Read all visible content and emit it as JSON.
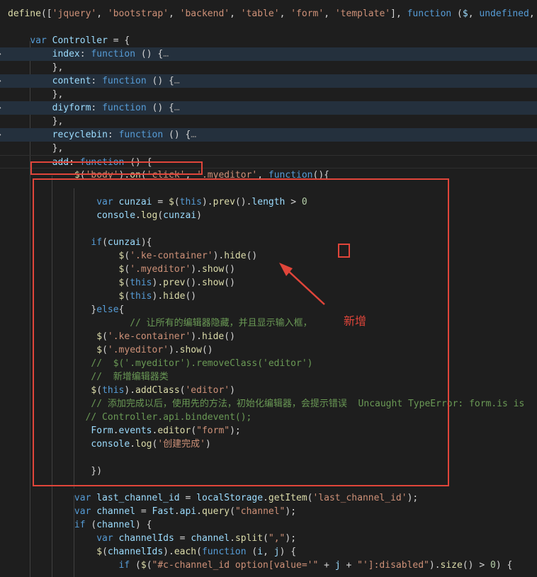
{
  "colors": {
    "background": "#1e1e1e",
    "fold_highlight": "#24303d",
    "annotation": "#e0453a",
    "keyword": "#569cd6",
    "string": "#ce9178",
    "function": "#dcdcaa",
    "variable": "#9cdcfe",
    "comment": "#6a9955",
    "number": "#b5cea8",
    "plain": "#d4d4d4"
  },
  "icons": {
    "fold": "chevron-right-icon"
  },
  "annotation": {
    "label": "新增"
  },
  "lines": [
    {
      "tokens": [
        [
          "define",
          "fn"
        ],
        [
          "([",
          "pl"
        ],
        [
          "'jquery'",
          "str"
        ],
        [
          ", ",
          "pl"
        ],
        [
          "'bootstrap'",
          "str"
        ],
        [
          ", ",
          "pl"
        ],
        [
          "'backend'",
          "str"
        ],
        [
          ", ",
          "pl"
        ],
        [
          "'table'",
          "str"
        ],
        [
          ", ",
          "pl"
        ],
        [
          "'form'",
          "str"
        ],
        [
          ", ",
          "pl"
        ],
        [
          "'template'",
          "str"
        ],
        [
          "], ",
          "pl"
        ],
        [
          "function",
          "kw"
        ],
        [
          " (",
          "pl"
        ],
        [
          "$",
          "var"
        ],
        [
          ", ",
          "pl"
        ],
        [
          "undefined",
          "kw"
        ],
        [
          ", B",
          "pl"
        ]
      ]
    },
    {
      "tokens": []
    },
    {
      "tokens": [
        [
          "    ",
          "pl"
        ],
        [
          "var",
          "kw"
        ],
        [
          " ",
          "pl"
        ],
        [
          "Controller",
          "var"
        ],
        [
          " = {",
          "pl"
        ]
      ]
    },
    {
      "fold": true,
      "tokens": [
        [
          "        ",
          "pl"
        ],
        [
          "index",
          "var"
        ],
        [
          ": ",
          "pl"
        ],
        [
          "function",
          "kw"
        ],
        [
          " () {",
          "pl"
        ],
        [
          "…",
          "ell"
        ]
      ]
    },
    {
      "tokens": [
        [
          "        },",
          "pl"
        ]
      ]
    },
    {
      "fold": true,
      "tokens": [
        [
          "        ",
          "pl"
        ],
        [
          "content",
          "var"
        ],
        [
          ": ",
          "pl"
        ],
        [
          "function",
          "kw"
        ],
        [
          " () {",
          "pl"
        ],
        [
          "…",
          "ell"
        ]
      ]
    },
    {
      "tokens": [
        [
          "        },",
          "pl"
        ]
      ]
    },
    {
      "fold": true,
      "tokens": [
        [
          "        ",
          "pl"
        ],
        [
          "diyform",
          "var"
        ],
        [
          ": ",
          "pl"
        ],
        [
          "function",
          "kw"
        ],
        [
          " () {",
          "pl"
        ],
        [
          "…",
          "ell"
        ]
      ]
    },
    {
      "tokens": [
        [
          "        },",
          "pl"
        ]
      ]
    },
    {
      "fold": true,
      "tokens": [
        [
          "        ",
          "pl"
        ],
        [
          "recyclebin",
          "var"
        ],
        [
          ": ",
          "pl"
        ],
        [
          "function",
          "kw"
        ],
        [
          " () {",
          "pl"
        ],
        [
          "…",
          "ell"
        ]
      ]
    },
    {
      "tokens": [
        [
          "        },",
          "pl"
        ]
      ]
    },
    {
      "current": true,
      "tokens": [
        [
          "        ",
          "pl"
        ],
        [
          "add",
          "var"
        ],
        [
          ": ",
          "pl"
        ],
        [
          "function",
          "kw"
        ],
        [
          " () {",
          "pl"
        ]
      ]
    },
    {
      "tokens": [
        [
          "            ",
          "pl"
        ],
        [
          "$",
          "fn"
        ],
        [
          "(",
          "pl"
        ],
        [
          "'body'",
          "str"
        ],
        [
          ").",
          "pl"
        ],
        [
          "on",
          "fn"
        ],
        [
          "(",
          "pl"
        ],
        [
          "'click'",
          "str"
        ],
        [
          ", ",
          "pl"
        ],
        [
          "'.myeditor'",
          "str"
        ],
        [
          ", ",
          "pl"
        ],
        [
          "function",
          "kw"
        ],
        [
          "(){",
          "pl"
        ]
      ]
    },
    {
      "tokens": []
    },
    {
      "tokens": [
        [
          "                ",
          "pl"
        ],
        [
          "var",
          "kw"
        ],
        [
          " ",
          "pl"
        ],
        [
          "cunzai",
          "var"
        ],
        [
          " = ",
          "pl"
        ],
        [
          "$",
          "fn"
        ],
        [
          "(",
          "pl"
        ],
        [
          "this",
          "kw"
        ],
        [
          ").",
          "pl"
        ],
        [
          "prev",
          "fn"
        ],
        [
          "().",
          "pl"
        ],
        [
          "length",
          "var"
        ],
        [
          " > ",
          "pl"
        ],
        [
          "0",
          "num"
        ]
      ]
    },
    {
      "tokens": [
        [
          "                ",
          "pl"
        ],
        [
          "console",
          "var"
        ],
        [
          ".",
          "pl"
        ],
        [
          "log",
          "fn"
        ],
        [
          "(",
          "pl"
        ],
        [
          "cunzai",
          "var"
        ],
        [
          ")",
          "pl"
        ]
      ]
    },
    {
      "tokens": []
    },
    {
      "tokens": [
        [
          "               ",
          "pl"
        ],
        [
          "if",
          "kw"
        ],
        [
          "(",
          "pl"
        ],
        [
          "cunzai",
          "var"
        ],
        [
          "){",
          "pl"
        ]
      ]
    },
    {
      "tokens": [
        [
          "                    ",
          "pl"
        ],
        [
          "$",
          "fn"
        ],
        [
          "(",
          "pl"
        ],
        [
          "'.ke-container'",
          "str"
        ],
        [
          ").",
          "pl"
        ],
        [
          "hide",
          "fn"
        ],
        [
          "()",
          "pl"
        ]
      ]
    },
    {
      "tokens": [
        [
          "                    ",
          "pl"
        ],
        [
          "$",
          "fn"
        ],
        [
          "(",
          "pl"
        ],
        [
          "'.myeditor'",
          "str"
        ],
        [
          ").",
          "pl"
        ],
        [
          "show",
          "fn"
        ],
        [
          "()",
          "pl"
        ]
      ]
    },
    {
      "tokens": [
        [
          "                    ",
          "pl"
        ],
        [
          "$",
          "fn"
        ],
        [
          "(",
          "pl"
        ],
        [
          "this",
          "kw"
        ],
        [
          ").",
          "pl"
        ],
        [
          "prev",
          "fn"
        ],
        [
          "().",
          "pl"
        ],
        [
          "show",
          "fn"
        ],
        [
          "()",
          "pl"
        ]
      ]
    },
    {
      "tokens": [
        [
          "                    ",
          "pl"
        ],
        [
          "$",
          "fn"
        ],
        [
          "(",
          "pl"
        ],
        [
          "this",
          "kw"
        ],
        [
          ").",
          "pl"
        ],
        [
          "hide",
          "fn"
        ],
        [
          "()",
          "pl"
        ]
      ]
    },
    {
      "tokens": [
        [
          "               }",
          "pl"
        ],
        [
          "else",
          "kw"
        ],
        [
          "{",
          "pl"
        ]
      ]
    },
    {
      "tokens": [
        [
          "                      ",
          "pl"
        ],
        [
          "// 让所有的编辑器隐藏，并且显示输入框，",
          "cm"
        ]
      ]
    },
    {
      "tokens": [
        [
          "                ",
          "pl"
        ],
        [
          "$",
          "fn"
        ],
        [
          "(",
          "pl"
        ],
        [
          "'.ke-container'",
          "str"
        ],
        [
          ").",
          "pl"
        ],
        [
          "hide",
          "fn"
        ],
        [
          "()",
          "pl"
        ]
      ]
    },
    {
      "tokens": [
        [
          "                ",
          "pl"
        ],
        [
          "$",
          "fn"
        ],
        [
          "(",
          "pl"
        ],
        [
          "'.myeditor'",
          "str"
        ],
        [
          ").",
          "pl"
        ],
        [
          "show",
          "fn"
        ],
        [
          "()",
          "pl"
        ]
      ]
    },
    {
      "tokens": [
        [
          "               ",
          "pl"
        ],
        [
          "//  $('.myeditor').removeClass('editor')",
          "cm"
        ]
      ]
    },
    {
      "tokens": [
        [
          "               ",
          "pl"
        ],
        [
          "//  新增编辑器类",
          "cm"
        ]
      ]
    },
    {
      "tokens": [
        [
          "               ",
          "pl"
        ],
        [
          "$",
          "fn"
        ],
        [
          "(",
          "pl"
        ],
        [
          "this",
          "kw"
        ],
        [
          ").",
          "pl"
        ],
        [
          "addClass",
          "fn"
        ],
        [
          "(",
          "pl"
        ],
        [
          "'editor'",
          "str"
        ],
        [
          ")",
          "pl"
        ]
      ]
    },
    {
      "tokens": [
        [
          "               ",
          "pl"
        ],
        [
          "// 添加完成以后，使用先的方法，初始化编辑器，会提示错误  Uncaught TypeError: form.is is",
          "cm"
        ]
      ]
    },
    {
      "tokens": [
        [
          "              ",
          "pl"
        ],
        [
          "// Controller.api.bindevent();",
          "cm"
        ]
      ]
    },
    {
      "tokens": [
        [
          "               ",
          "pl"
        ],
        [
          "Form",
          "var"
        ],
        [
          ".",
          "pl"
        ],
        [
          "events",
          "var"
        ],
        [
          ".",
          "pl"
        ],
        [
          "editor",
          "fn"
        ],
        [
          "(",
          "pl"
        ],
        [
          "\"form\"",
          "str"
        ],
        [
          ");",
          "pl"
        ]
      ]
    },
    {
      "tokens": [
        [
          "               ",
          "pl"
        ],
        [
          "console",
          "var"
        ],
        [
          ".",
          "pl"
        ],
        [
          "log",
          "fn"
        ],
        [
          "(",
          "pl"
        ],
        [
          "'创建完成'",
          "str"
        ],
        [
          ")",
          "pl"
        ]
      ]
    },
    {
      "tokens": []
    },
    {
      "tokens": [
        [
          "               })",
          "pl"
        ]
      ]
    },
    {
      "tokens": []
    },
    {
      "tokens": [
        [
          "            ",
          "pl"
        ],
        [
          "var",
          "kw"
        ],
        [
          " ",
          "pl"
        ],
        [
          "last_channel_id",
          "var"
        ],
        [
          " = ",
          "pl"
        ],
        [
          "localStorage",
          "var"
        ],
        [
          ".",
          "pl"
        ],
        [
          "getItem",
          "fn"
        ],
        [
          "(",
          "pl"
        ],
        [
          "'last_channel_id'",
          "str"
        ],
        [
          ");",
          "pl"
        ]
      ]
    },
    {
      "tokens": [
        [
          "            ",
          "pl"
        ],
        [
          "var",
          "kw"
        ],
        [
          " ",
          "pl"
        ],
        [
          "channel",
          "var"
        ],
        [
          " = ",
          "pl"
        ],
        [
          "Fast",
          "var"
        ],
        [
          ".",
          "pl"
        ],
        [
          "api",
          "var"
        ],
        [
          ".",
          "pl"
        ],
        [
          "query",
          "fn"
        ],
        [
          "(",
          "pl"
        ],
        [
          "\"channel\"",
          "str"
        ],
        [
          ");",
          "pl"
        ]
      ]
    },
    {
      "tokens": [
        [
          "            ",
          "pl"
        ],
        [
          "if",
          "kw"
        ],
        [
          " (",
          "pl"
        ],
        [
          "channel",
          "var"
        ],
        [
          ") {",
          "pl"
        ]
      ]
    },
    {
      "tokens": [
        [
          "                ",
          "pl"
        ],
        [
          "var",
          "kw"
        ],
        [
          " ",
          "pl"
        ],
        [
          "channelIds",
          "var"
        ],
        [
          " = ",
          "pl"
        ],
        [
          "channel",
          "var"
        ],
        [
          ".",
          "pl"
        ],
        [
          "split",
          "fn"
        ],
        [
          "(",
          "pl"
        ],
        [
          "\",\"",
          "str"
        ],
        [
          ");",
          "pl"
        ]
      ]
    },
    {
      "tokens": [
        [
          "                ",
          "pl"
        ],
        [
          "$",
          "fn"
        ],
        [
          "(",
          "pl"
        ],
        [
          "channelIds",
          "var"
        ],
        [
          ").",
          "pl"
        ],
        [
          "each",
          "fn"
        ],
        [
          "(",
          "pl"
        ],
        [
          "function",
          "kw"
        ],
        [
          " (",
          "pl"
        ],
        [
          "i",
          "var"
        ],
        [
          ", ",
          "pl"
        ],
        [
          "j",
          "var"
        ],
        [
          ") {",
          "pl"
        ]
      ]
    },
    {
      "tokens": [
        [
          "                    ",
          "pl"
        ],
        [
          "if",
          "kw"
        ],
        [
          " (",
          "pl"
        ],
        [
          "$",
          "fn"
        ],
        [
          "(",
          "pl"
        ],
        [
          "\"#c-channel_id option[value='\"",
          "str"
        ],
        [
          " + ",
          "pl"
        ],
        [
          "j",
          "var"
        ],
        [
          " + ",
          "pl"
        ],
        [
          "\"']:disabled\"",
          "str"
        ],
        [
          ").",
          "pl"
        ],
        [
          "size",
          "fn"
        ],
        [
          "() > ",
          "pl"
        ],
        [
          "0",
          "num"
        ],
        [
          ") {",
          "pl"
        ]
      ]
    }
  ]
}
